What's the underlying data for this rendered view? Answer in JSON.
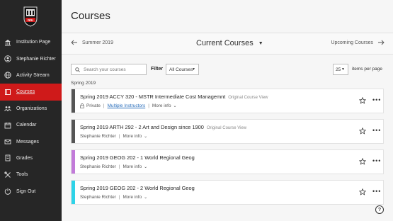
{
  "sidebar": {
    "logo_text": "NIU",
    "items": [
      {
        "label": "Institution Page",
        "icon": "institution-icon",
        "active": false
      },
      {
        "label": "Stephanie Richter",
        "icon": "user-icon",
        "active": false
      },
      {
        "label": "Activity Stream",
        "icon": "globe-icon",
        "active": false
      },
      {
        "label": "Courses",
        "icon": "book-icon",
        "active": true
      },
      {
        "label": "Organizations",
        "icon": "organizations-icon",
        "active": false
      },
      {
        "label": "Calendar",
        "icon": "calendar-icon",
        "active": false
      },
      {
        "label": "Messages",
        "icon": "envelope-icon",
        "active": false
      },
      {
        "label": "Grades",
        "icon": "grades-icon",
        "active": false
      },
      {
        "label": "Tools",
        "icon": "tools-icon",
        "active": false
      },
      {
        "label": "Sign Out",
        "icon": "sign-out-icon",
        "active": false
      }
    ]
  },
  "header": {
    "title": "Courses",
    "prev_term": "Summer 2019",
    "current_term": "Current Courses",
    "next_term": "Upcoming Courses"
  },
  "toolbar": {
    "search_placeholder": "Search your courses",
    "filter_label": "Filter",
    "filter_value": "All Courses",
    "per_page_value": "25",
    "per_page_label": "items per page"
  },
  "term_heading": "Spring 2019",
  "courses": [
    {
      "title": "Spring 2019 ACCY 320 - MSTR Intermediate Cost Managemnt",
      "view": "Original Course View",
      "privacy": "Private",
      "instructor": "Multiple Instructors",
      "more": "More info",
      "color": "#555555"
    },
    {
      "title": "Spring 2019 ARTH 292 - 2 Art and Design since 1900",
      "view": "Original Course View",
      "instructor": "Stephanie Richter",
      "more": "More info",
      "color": "#555555"
    },
    {
      "title": "Spring 2019 GEOG 202 - 1 World Regional Geog",
      "view": "",
      "instructor": "Stephanie Richter",
      "more": "More info",
      "color": "#c27bd9"
    },
    {
      "title": "Spring 2019 GEOG 202 - 2 World Regional Geog",
      "view": "",
      "instructor": "Stephanie Richter",
      "more": "More info",
      "color": "#2ed3e8"
    }
  ],
  "help_label": "?",
  "colors": {
    "sidebar": "#262626",
    "active": "#cf1a1a",
    "link": "#2a6ebb"
  }
}
